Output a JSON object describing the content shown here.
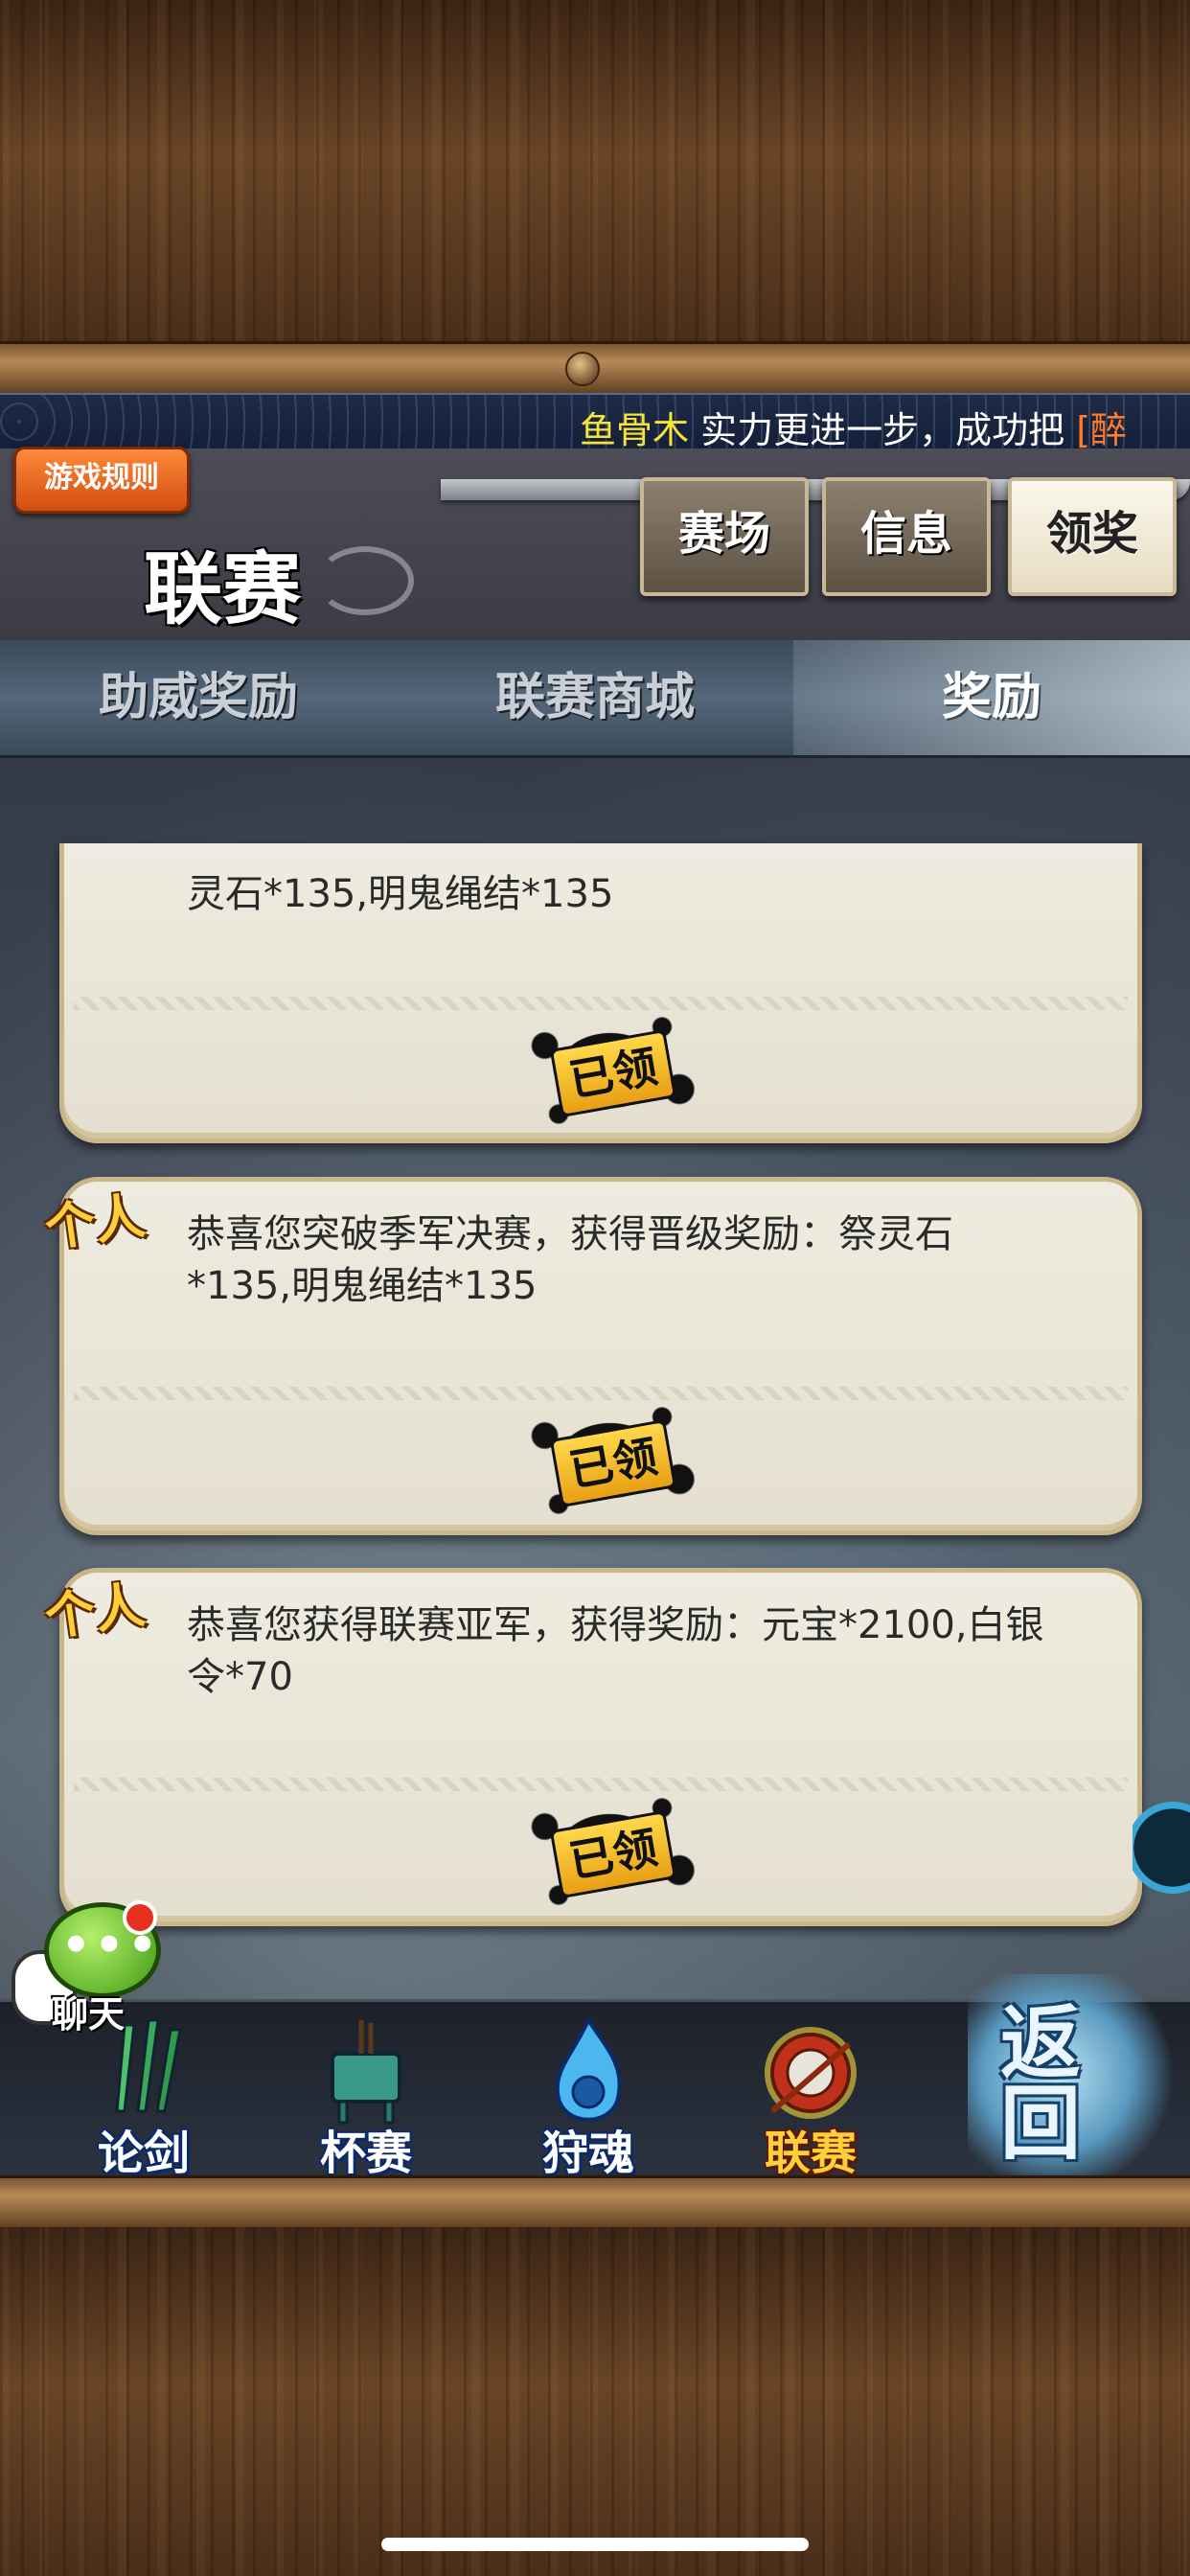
{
  "marquee": {
    "name": "鱼骨木",
    "text": " 实力更进一步，成功把 ",
    "tag": "[醉"
  },
  "header": {
    "rules_button": "游戏规则",
    "title": "联赛",
    "top_tabs": [
      {
        "label": "赛场",
        "active": false
      },
      {
        "label": "信息",
        "active": false
      },
      {
        "label": "领奖",
        "active": true
      }
    ]
  },
  "sub_tabs": [
    {
      "label": "助威奖励",
      "active": false
    },
    {
      "label": "联赛商城",
      "active": false
    },
    {
      "label": "奖励",
      "active": true
    }
  ],
  "rewards": [
    {
      "badge": "",
      "message": "灵石*135,明鬼绳结*135",
      "status": "已领"
    },
    {
      "badge": "个人",
      "message": "恭喜您突破季军决赛，获得晋级奖励：祭灵石*135,明鬼绳结*135",
      "status": "已领"
    },
    {
      "badge": "个人",
      "message": "恭喜您获得联赛亚军，获得奖励：元宝*2100,白银令*70",
      "status": "已领"
    }
  ],
  "chat": {
    "label": "聊天"
  },
  "nav": {
    "items": [
      {
        "label": "论剑",
        "icon": "swords-icon"
      },
      {
        "label": "杯赛",
        "icon": "bronze-cauldron-icon"
      },
      {
        "label": "狩魂",
        "icon": "blue-flame-icon"
      },
      {
        "label": "联赛",
        "icon": "drum-icon",
        "active": true
      }
    ],
    "back_label": "返回"
  },
  "colors": {
    "accent_gold": "#ffcf3a",
    "rules_orange": "#e8651e",
    "card_bg": "#eeebe0"
  }
}
